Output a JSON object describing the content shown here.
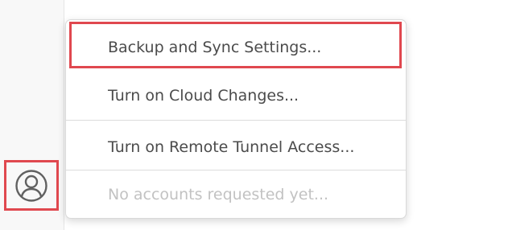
{
  "activity_bar": {
    "accounts_icon": "account-circle-icon"
  },
  "menu": {
    "items": [
      {
        "label": "Backup and Sync Settings...",
        "enabled": true
      },
      {
        "label": "Turn on Cloud Changes...",
        "enabled": true
      },
      {
        "label": "Turn on Remote Tunnel Access...",
        "enabled": true
      },
      {
        "label": "No accounts requested yet...",
        "enabled": false
      }
    ]
  },
  "colors": {
    "highlight": "#e0484f",
    "text": "#4b4b4b",
    "disabled_text": "#c2c2c2"
  }
}
